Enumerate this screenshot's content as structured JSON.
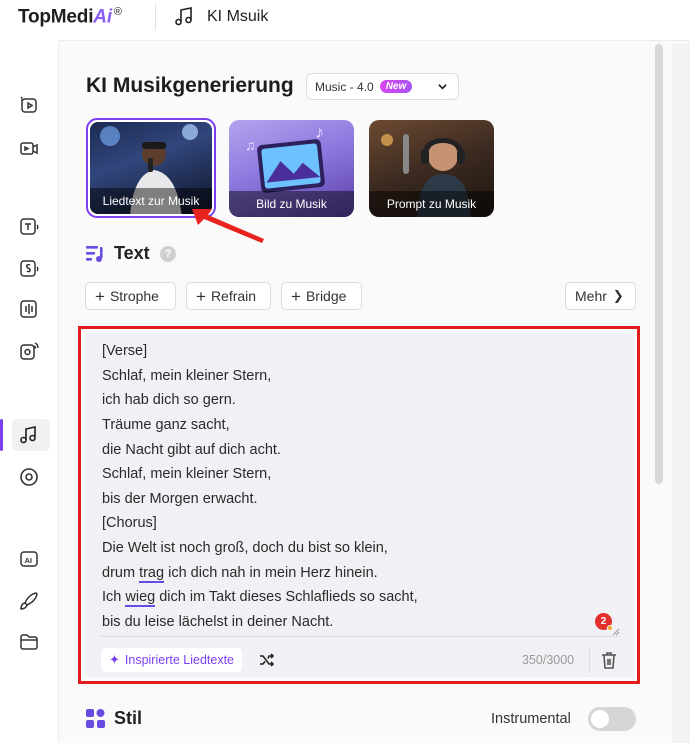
{
  "header": {
    "logo_main": "TopMedi",
    "logo_ai": "Ai",
    "logo_reg": "®",
    "app_title": "KI Msuik"
  },
  "rail": {
    "icons": [
      "video-enhance-icon",
      "video-camera-icon",
      "text-to-speech-icon",
      "speech-icon",
      "voice-icon",
      "voice-clone-icon",
      "music-icon",
      "disc-icon",
      "ai-icon",
      "brush-icon",
      "folder-icon"
    ],
    "active": "music-icon"
  },
  "main": {
    "title": "KI Musikgenerierung",
    "model": {
      "value": "Music - 4.0",
      "badge": "New"
    },
    "modes": [
      {
        "label": "Liedtext zur Musik",
        "selected": true
      },
      {
        "label": "Bild zu Musik",
        "selected": false
      },
      {
        "label": "Prompt zu Musik",
        "selected": false
      }
    ],
    "text_section": {
      "title": "Text",
      "help": "?",
      "chips": [
        "Strophe",
        "Refrain",
        "Bridge"
      ],
      "more": "Mehr"
    },
    "lyrics": {
      "lines": [
        "[Verse]",
        "Schlaf, mein kleiner Stern,",
        "ich hab dich so gern.",
        "Träume ganz sacht,",
        "die Nacht gibt auf dich acht.",
        "Schlaf, mein kleiner Stern,",
        "bis der Morgen erwacht.",
        "[Chorus]",
        "Die Welt ist noch groß, doch du bist so klein,"
      ],
      "line10_pre": "drum ",
      "line10_u": "trag",
      "line10_post": " ich dich nah in mein Herz hinein.",
      "line11_pre": "Ich ",
      "line11_u": "wieg",
      "line11_post": " dich im Takt dieses Schlaflieds so sacht,",
      "line12": "bis du leise lächelst in deiner Nacht.",
      "notification_count": "2",
      "inspired_label": "Inspirierte Liedtexte",
      "counter": "350/3000"
    },
    "style_section": {
      "title": "Stil",
      "instrumental_label": "Instrumental",
      "instrumental_on": false
    }
  },
  "colors": {
    "accent": "#7b3ff2",
    "highlight_red": "#e01c1c",
    "badge_gradient_start": "#d946ef",
    "badge_gradient_end": "#a855f7"
  }
}
